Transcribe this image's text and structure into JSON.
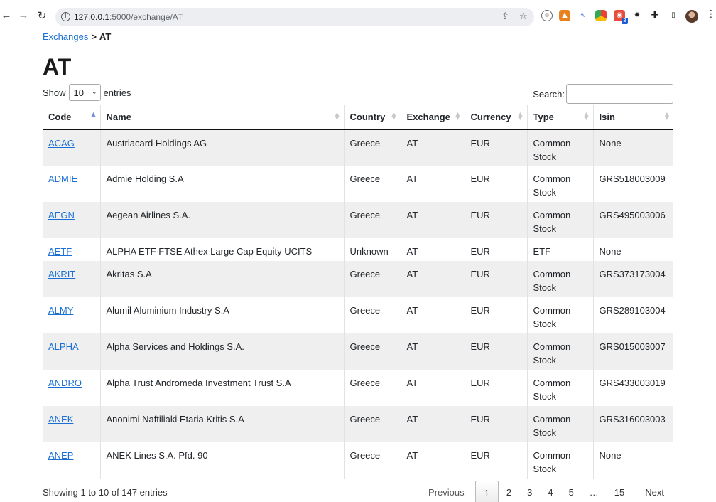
{
  "browser": {
    "url_host": "127.0.0.1",
    "url_rest": ":5000/exchange/AT"
  },
  "breadcrumb": {
    "parent": "Exchanges",
    "separator": ">",
    "current": "AT"
  },
  "page_title": "AT",
  "length_menu": {
    "prefix": "Show",
    "value": "10",
    "suffix": "entries"
  },
  "search": {
    "label": "Search:",
    "value": ""
  },
  "table": {
    "columns": [
      "Code",
      "Name",
      "Country",
      "Exchange",
      "Currency",
      "Type",
      "Isin"
    ],
    "rows": [
      {
        "code": "ACAG",
        "name": "Austriacard Holdings AG",
        "country": "Greece",
        "exchange": "AT",
        "currency": "EUR",
        "type1": "Common",
        "type2": "Stock",
        "isin": "None"
      },
      {
        "code": "ADMIE",
        "name": "Admie Holding S.A",
        "country": "Greece",
        "exchange": "AT",
        "currency": "EUR",
        "type1": "Common",
        "type2": "Stock",
        "isin": "GRS518003009"
      },
      {
        "code": "AEGN",
        "name": "Aegean Airlines S.A.",
        "country": "Greece",
        "exchange": "AT",
        "currency": "EUR",
        "type1": "Common",
        "type2": "Stock",
        "isin": "GRS495003006"
      },
      {
        "code": "AETF",
        "name": "ALPHA ETF FTSE Athex Large Cap Equity UCITS",
        "country": "Unknown",
        "exchange": "AT",
        "currency": "EUR",
        "type1": "ETF",
        "type2": "",
        "isin": "None"
      },
      {
        "code": "AKRIT",
        "name": "Akritas S.A",
        "country": "Greece",
        "exchange": "AT",
        "currency": "EUR",
        "type1": "Common",
        "type2": "Stock",
        "isin": "GRS373173004"
      },
      {
        "code": "ALMY",
        "name": "Alumil Aluminium Industry S.A",
        "country": "Greece",
        "exchange": "AT",
        "currency": "EUR",
        "type1": "Common",
        "type2": "Stock",
        "isin": "GRS289103004"
      },
      {
        "code": "ALPHA",
        "name": "Alpha Services and Holdings S.A.",
        "country": "Greece",
        "exchange": "AT",
        "currency": "EUR",
        "type1": "Common",
        "type2": "Stock",
        "isin": "GRS015003007"
      },
      {
        "code": "ANDRO",
        "name": "Alpha Trust Andromeda Investment Trust S.A",
        "country": "Greece",
        "exchange": "AT",
        "currency": "EUR",
        "type1": "Common",
        "type2": "Stock",
        "isin": "GRS433003019"
      },
      {
        "code": "ANEK",
        "name": "Anonimi Naftiliaki Etaria Kritis S.A",
        "country": "Greece",
        "exchange": "AT",
        "currency": "EUR",
        "type1": "Common",
        "type2": "Stock",
        "isin": "GRS316003003"
      },
      {
        "code": "ANEP",
        "name": "ANEK Lines S.A. Pfd. 90",
        "country": "Greece",
        "exchange": "AT",
        "currency": "EUR",
        "type1": "Common",
        "type2": "Stock",
        "isin": "None"
      }
    ]
  },
  "info": "Showing 1 to 10 of 147 entries",
  "pagination": {
    "previous": "Previous",
    "pages": [
      "1",
      "2",
      "3",
      "4",
      "5",
      "…",
      "15"
    ],
    "next": "Next"
  },
  "colors": {
    "link": "#1a6fd4",
    "stripe": "#efefef"
  }
}
